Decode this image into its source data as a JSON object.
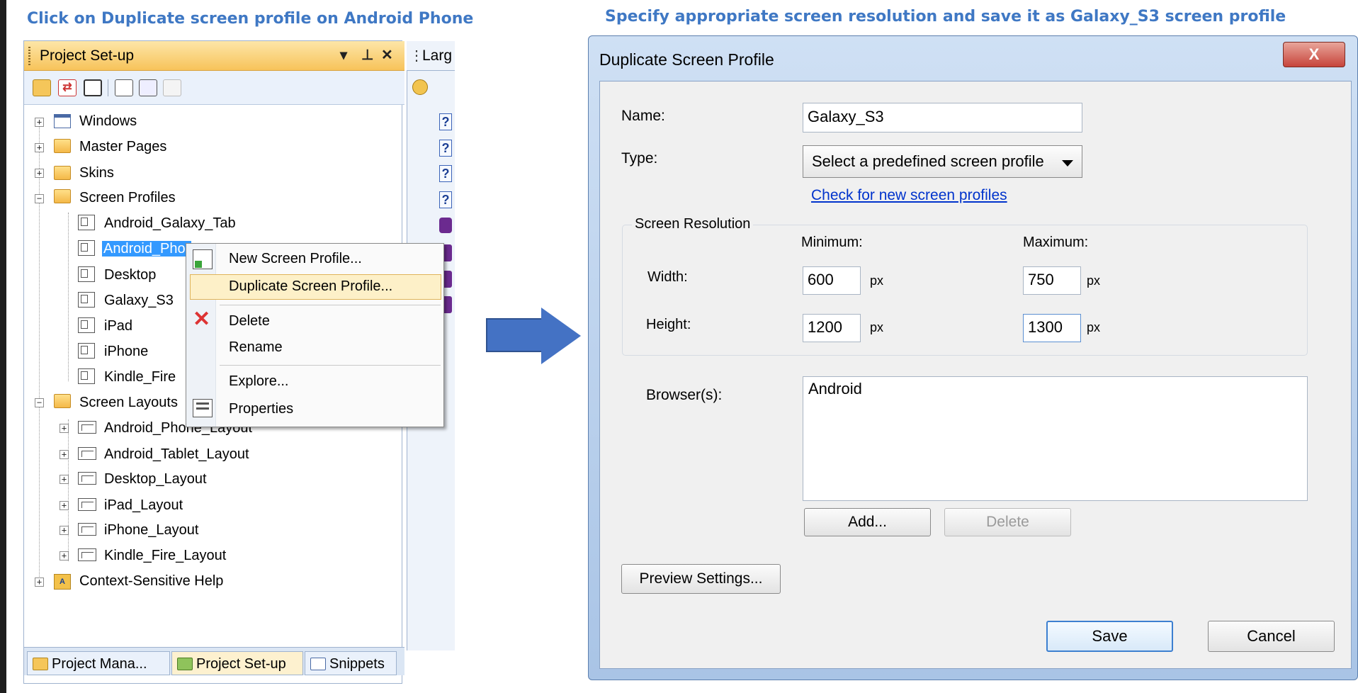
{
  "captions": {
    "left": "Click on Duplicate screen profile on Android Phone",
    "right": "Specify appropriate screen resolution and save it as Galaxy_S3 screen profile"
  },
  "panel": {
    "title": "Project Set-up",
    "title_controls": [
      "▾",
      "⊥",
      "✕"
    ],
    "right_tab_label": "Larg",
    "tree": {
      "windows": "Windows",
      "master_pages": "Master Pages",
      "skins": "Skins",
      "screen_profiles": "Screen Profiles",
      "profiles": [
        "Android_Galaxy_Tab",
        "Android_Phone",
        "Desktop",
        "Galaxy_S3",
        "iPad",
        "iPhone",
        "Kindle_Fire"
      ],
      "selected_profile_visible": "Android_Phor",
      "screen_layouts": "Screen Layouts",
      "layouts": [
        "Android_Phone_Layout",
        "Android_Tablet_Layout",
        "Desktop_Layout",
        "iPad_Layout",
        "iPhone_Layout",
        "Kindle_Fire_Layout"
      ],
      "context_help": "Context-Sensitive Help"
    },
    "bottom_tabs": [
      "Project Mana...",
      "Project Set-up",
      "Snippets"
    ]
  },
  "context_menu": {
    "new": "New Screen Profile...",
    "duplicate": "Duplicate Screen Profile...",
    "delete": "Delete",
    "rename": "Rename",
    "explore": "Explore...",
    "properties": "Properties"
  },
  "dialog": {
    "title": "Duplicate Screen Profile",
    "close_glyph": "X",
    "name_label": "Name:",
    "name_value": "Galaxy_S3",
    "type_label": "Type:",
    "type_value": "Select a predefined screen profile",
    "check_link": "Check for new screen profiles",
    "resolution_group": "Screen Resolution",
    "minimum_label": "Minimum:",
    "maximum_label": "Maximum:",
    "width_label": "Width:",
    "height_label": "Height:",
    "min_width": "600",
    "max_width": "750",
    "min_height": "1200",
    "max_height": "1300",
    "unit": "px",
    "browsers_label": "Browser(s):",
    "browsers": [
      "Android"
    ],
    "add_button": "Add...",
    "delete_button": "Delete",
    "preview_button": "Preview Settings...",
    "save_button": "Save",
    "cancel_button": "Cancel"
  }
}
